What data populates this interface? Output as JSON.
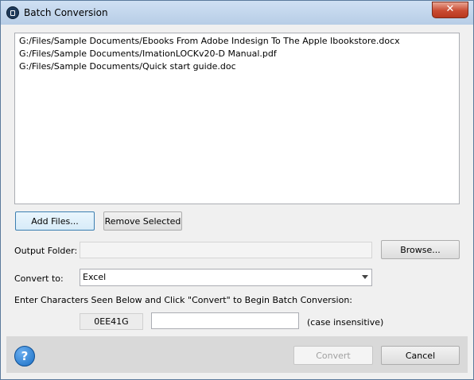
{
  "window": {
    "title": "Batch Conversion",
    "close_label": "✕"
  },
  "files": [
    "G:/Files/Sample Documents/Ebooks From Adobe Indesign To The Apple Ibookstore.docx",
    "G:/Files/Sample Documents/ImationLOCKv20-D Manual.pdf",
    "G:/Files/Sample Documents/Quick start guide.doc"
  ],
  "buttons": {
    "add_files": "Add Files...",
    "remove_selected": "Remove Selected",
    "browse": "Browse...",
    "convert": "Convert",
    "cancel": "Cancel"
  },
  "output_folder": {
    "label": "Output Folder:",
    "value": ""
  },
  "convert_to": {
    "label": "Convert to:",
    "selected": "Excel"
  },
  "captcha": {
    "instruction": "Enter Characters Seen Below and Click \"Convert\" to Begin Batch Conversion:",
    "code": "0EE41G",
    "input_value": "",
    "hint": "(case insensitive)"
  },
  "help": {
    "glyph": "?"
  }
}
